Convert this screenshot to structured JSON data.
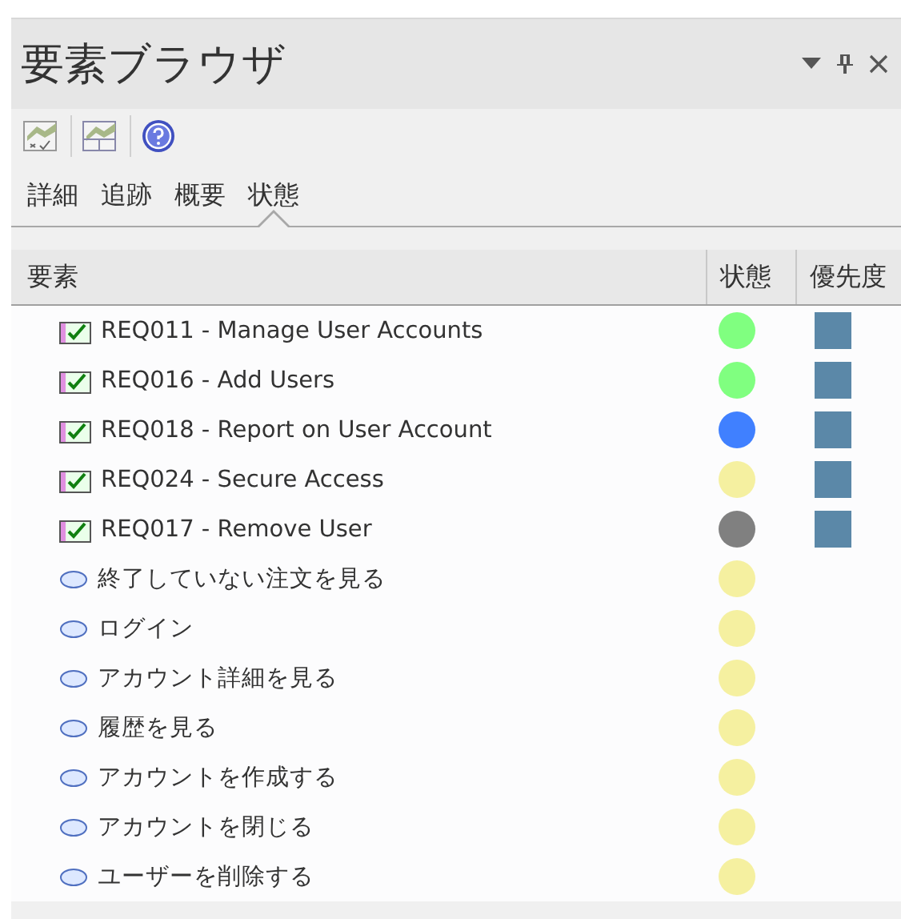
{
  "window": {
    "title": "要素ブラウザ"
  },
  "tabs": [
    {
      "label": "詳細",
      "selected": false
    },
    {
      "label": "追跡",
      "selected": false
    },
    {
      "label": "概要",
      "selected": false
    },
    {
      "label": "状態",
      "selected": true
    }
  ],
  "table": {
    "columns": [
      "要素",
      "状態",
      "優先度"
    ],
    "rows": [
      {
        "kind": "requirement",
        "name": "REQ011 - Manage User Accounts",
        "color": "#80ff80",
        "priority": {
          "color": "#5b88a8"
        }
      },
      {
        "kind": "requirement",
        "name": "REQ016 - Add Users",
        "color": "#80ff80",
        "priority": {
          "color": "#5b88a8"
        }
      },
      {
        "kind": "requirement",
        "name": "REQ018 - Report on User Account",
        "color": "#4080ff",
        "priority": {
          "color": "#5b88a8"
        }
      },
      {
        "kind": "requirement",
        "name": "REQ024 - Secure Access",
        "color": "#f5f0a0",
        "priority": {
          "color": "#5b88a8"
        }
      },
      {
        "kind": "requirement",
        "name": "REQ017 - Remove User",
        "color": "#808080",
        "priority": {
          "color": "#5b88a8"
        }
      },
      {
        "kind": "use_case",
        "name": "終了していない注文を見る",
        "color": "#f5f0a0"
      },
      {
        "kind": "use_case",
        "name": "ログイン",
        "color": "#f5f0a0"
      },
      {
        "kind": "use_case",
        "name": "アカウント詳細を見る",
        "color": "#f5f0a0"
      },
      {
        "kind": "use_case",
        "name": "履歴を見る",
        "color": "#f5f0a0"
      },
      {
        "kind": "use_case",
        "name": "アカウントを作成する",
        "color": "#f5f0a0"
      },
      {
        "kind": "use_case",
        "name": "アカウントを閉じる",
        "color": "#f5f0a0"
      },
      {
        "kind": "use_case",
        "name": "ユーザーを削除する",
        "color": "#f5f0a0"
      }
    ]
  }
}
